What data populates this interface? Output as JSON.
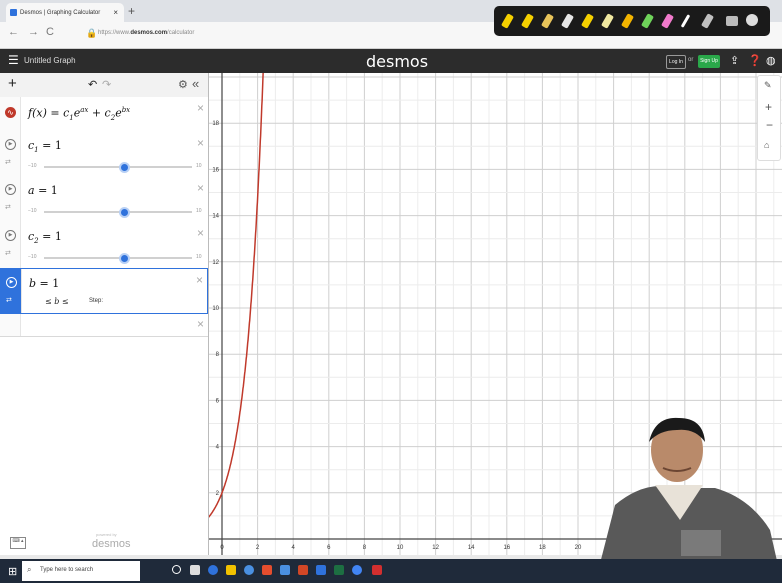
{
  "browser": {
    "tab_title": "Desmos | Graphing Calculator",
    "tab_close": "×",
    "new_tab": "+",
    "back": "←",
    "forward": "→",
    "reload": "C",
    "url_prefix": "https://www.",
    "url_domain": "desmos.com",
    "url_path": "/calculator"
  },
  "header": {
    "menu_icon": "☰",
    "title": "Untitled Graph",
    "logo": "desmos",
    "login": "Log In",
    "or": "or",
    "signup": "Sign Up",
    "share_icon": "share-icon",
    "help_icon": "help-icon",
    "language_icon": "globe-icon"
  },
  "panel": {
    "add": "+",
    "undo": "↶",
    "redo": "↷",
    "settings": "⚙",
    "collapse": "«",
    "expressions": [
      {
        "latex_main": "f(x) = c",
        "sub1": "1",
        "mid": "e",
        "sup1": "ax",
        "plus": " + c",
        "sub2": "2",
        "mid2": "e",
        "sup2": "bx"
      },
      {
        "name": "c",
        "sub": "1",
        "eq": "= 1",
        "min": "−10",
        "max": "10",
        "value": 1
      },
      {
        "name": "a",
        "sub": "",
        "eq": "= 1",
        "min": "−10",
        "max": "10",
        "value": 1
      },
      {
        "name": "c",
        "sub": "2",
        "eq": "= 1",
        "min": "−10",
        "max": "10",
        "value": 1
      },
      {
        "name": "b",
        "eq": "= 1",
        "range_le": "≤ b ≤",
        "step_label": "Step:"
      }
    ],
    "close_x": "×",
    "powered_by": "powered by",
    "footer_logo": "desmos",
    "keyboard_label": "⌨ ▴"
  },
  "graph": {
    "x_ticks": [
      "0",
      "2",
      "4",
      "6",
      "8",
      "10",
      "12",
      "14",
      "16",
      "18",
      "20",
      "30"
    ],
    "y_ticks": [
      "18",
      "16",
      "14",
      "12",
      "10",
      "8",
      "6",
      "4",
      "2"
    ],
    "curve_color": "#c0392b",
    "tools": {
      "wrench": "🔧",
      "zoom_in": "+",
      "zoom_out": "−",
      "home": "⌂"
    }
  },
  "taskbar": {
    "start": "⊞",
    "search_placeholder": "Type here to search",
    "search_icon": "search-icon"
  },
  "colors": {
    "accent": "#2f72dc",
    "header_bg": "#2c2c2c",
    "signup": "#2aa84a",
    "curve": "#c0392b"
  }
}
